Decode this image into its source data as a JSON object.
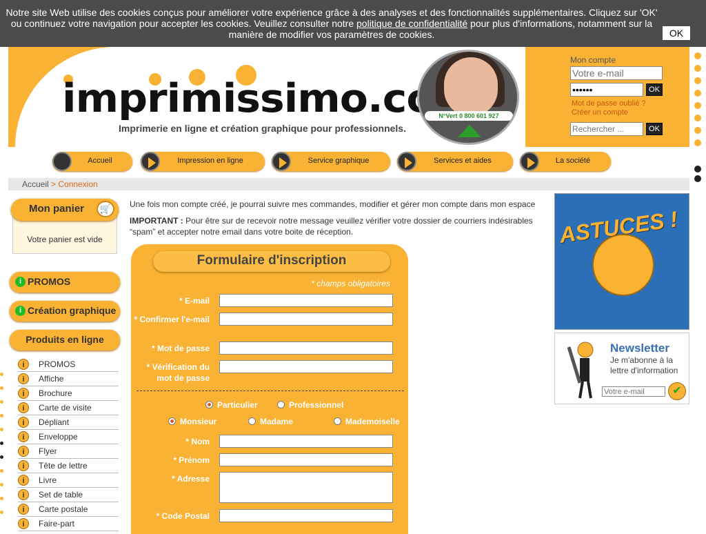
{
  "cookie": {
    "text_before": "Notre site Web utilise des cookies conçus pour améliorer votre expérience grâce à des analyses et des fonctionnalités supplémentaires. Cliquez sur 'OK' ou continuez votre navigation pour accepter les cookies. Veuillez consulter notre ",
    "link": "politique de confidentialité",
    "text_after": " pour plus d'informations, notamment sur la manière de modifier vos paramètres de cookies.",
    "ok_label": "OK"
  },
  "header": {
    "logo_text": "imprimissimo.com",
    "tagline": "Imprimerie en ligne et création graphique pour professionnels.",
    "numero_vert": "N°Vert 0 800 601 927"
  },
  "account": {
    "title": "Mon compte",
    "email_placeholder": "Votre e-mail",
    "password_value": "••••••",
    "ok_label": "OK",
    "forgot": "Mot de passe oublié ?",
    "create": "Créer un compte",
    "search_placeholder": "Rechercher ...",
    "search_ok": "OK"
  },
  "nav": [
    "Accueil",
    "Impression en ligne",
    "Service graphique",
    "Services et aides",
    "La société"
  ],
  "breadcrumb": {
    "home": "Accueil",
    "sep": " > ",
    "current": "Connexion"
  },
  "cart": {
    "title": "Mon panier",
    "empty": "Votre panier est vide"
  },
  "sidebar": {
    "promos": "PROMOS",
    "creation": "Création graphique",
    "produits": "Produits en ligne",
    "items": [
      "PROMOS",
      "Affiche",
      "Brochure",
      "Carte de visite",
      "Dépliant",
      "Enveloppe",
      "Flyer",
      "Tête de lettre",
      "Livre",
      "Set de table",
      "Carte postale",
      "Faire-part"
    ]
  },
  "main": {
    "intro": "Une fois mon compte créé, je pourrai suivre mes commandes, modifier et gérer mon compte dans mon espace",
    "important_label": "IMPORTANT :",
    "important_text": " Pour être sur de recevoir notre message veuillez vérifier votre dossier de courriers indésirables “spam” et accepter notre email dans votre boite de réception."
  },
  "form": {
    "title": "Formulaire d'inscription",
    "required_note": "* champs obligatoires",
    "email": "* E-mail",
    "confirm_email": "* Confirmer l'e-mail",
    "password": "* Mot de passe",
    "verify_password": "* Vérification du mot de passe",
    "type_options": [
      "Particulier",
      "Professionnel"
    ],
    "type_selected": "Particulier",
    "civility_options": [
      "Monsieur",
      "Madame",
      "Mademoiselle"
    ],
    "civility_selected": "Monsieur",
    "nom": "* Nom",
    "prenom": "* Prénom",
    "adresse": "* Adresse",
    "code_postal": "* Code Postal"
  },
  "right": {
    "astuces": "ASTUCES !",
    "newsletter_title": "Newsletter",
    "newsletter_sub": "Je m'abonne à la lettre d'information",
    "newsletter_placeholder": "Votre e-mail"
  },
  "colors": {
    "brand": "#f9b233",
    "dark": "#4b4b4b",
    "link": "#c55a11"
  }
}
